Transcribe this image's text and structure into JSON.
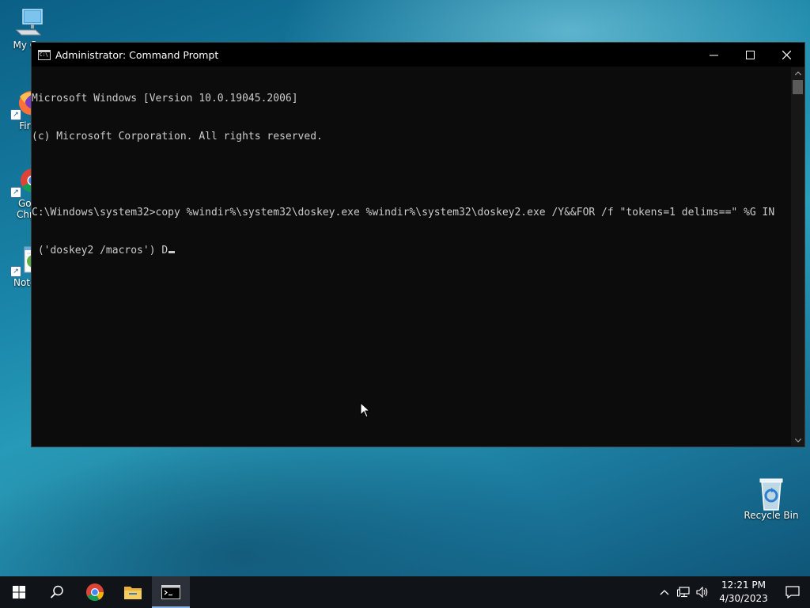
{
  "desktop": {
    "icons": [
      {
        "label": "My Co"
      },
      {
        "label": "Fire"
      },
      {
        "label": "Goo\nChro"
      },
      {
        "label": "Notep"
      },
      {
        "label": "Recycle Bin"
      }
    ]
  },
  "window": {
    "title": "Administrator: Command Prompt",
    "minimize_glyph": "—",
    "close_glyph": "✕"
  },
  "console": {
    "lines": [
      "Microsoft Windows [Version 10.0.19045.2006]",
      "(c) Microsoft Corporation. All rights reserved.",
      "",
      "C:\\Windows\\system32>copy %windir%\\system32\\doskey.exe %windir%\\system32\\doskey2.exe /Y&&FOR /f \"tokens=1 delims==\" %G IN",
      " ('doskey2 /macros') D"
    ]
  },
  "taskbar": {
    "clock_time": "12:21 PM",
    "clock_date": "4/30/2023"
  },
  "colors": {
    "console_bg": "#0c0c0c",
    "console_text": "#cccccc",
    "taskbar_bg": "#101318",
    "active_indicator": "#8ab4e8"
  }
}
